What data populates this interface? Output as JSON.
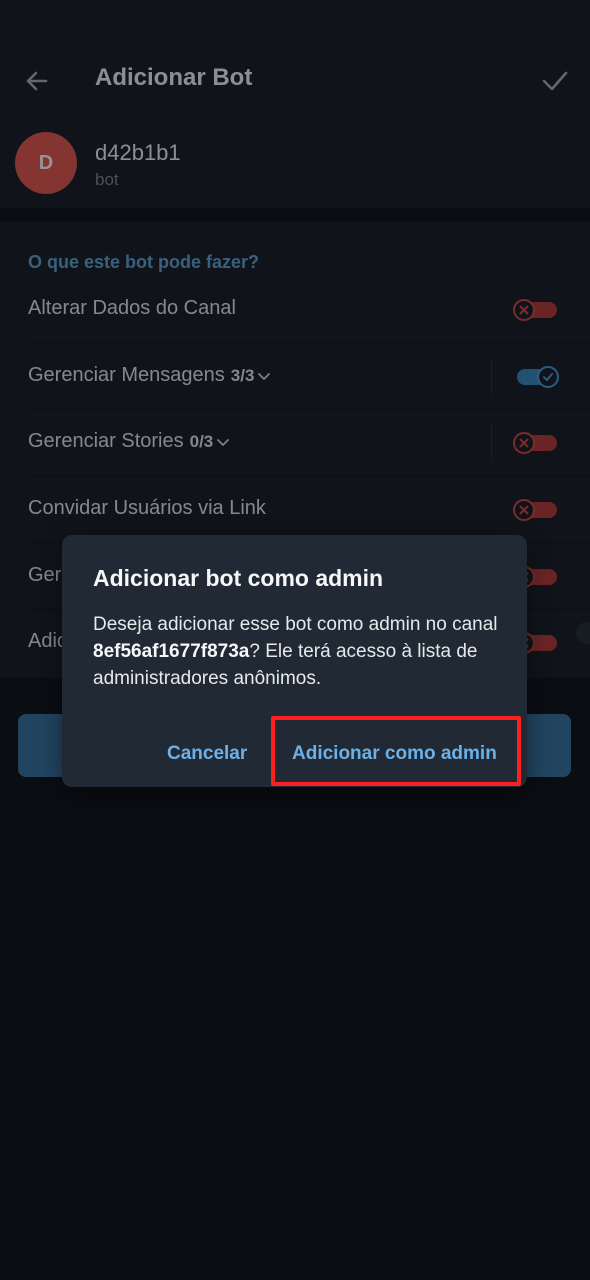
{
  "header": {
    "title": "Adicionar Bot",
    "back_icon": "arrow-left-icon",
    "confirm_icon": "check-icon"
  },
  "bot": {
    "avatar_letter": "D",
    "avatar_color": "#e35a55",
    "name": "d42b1b1",
    "subtitle": "bot"
  },
  "permissions": {
    "header": "O que este bot pode fazer?",
    "items": [
      {
        "label": "Alterar Dados do Canal",
        "count": "",
        "expandable": false,
        "enabled": false
      },
      {
        "label": "Gerenciar Mensagens",
        "count": "3/3",
        "expandable": true,
        "enabled": true
      },
      {
        "label": "Gerenciar Stories",
        "count": "0/3",
        "expandable": true,
        "enabled": false
      },
      {
        "label": "Convidar Usuários via Link",
        "count": "",
        "expandable": false,
        "enabled": false
      },
      {
        "label": "Gerenciar Transmissões",
        "count": "",
        "expandable": false,
        "enabled": false
      },
      {
        "label": "Adicionar Novos Admins",
        "count": "",
        "expandable": false,
        "enabled": false
      }
    ]
  },
  "dialog": {
    "title": "Adicionar bot como admin",
    "body_prefix": "Deseja adicionar esse bot como admin no canal ",
    "channel": "8ef56af1677f873a",
    "body_suffix": "? Ele terá acesso à lista de administradores anônimos.",
    "cancel_label": "Cancelar",
    "confirm_label": "Adicionar como admin"
  },
  "colors": {
    "background": "#121820",
    "surface": "#1c242e",
    "accent": "#62a7d8",
    "toggle_off": "#d64a4a",
    "toggle_on": "#4c9fe0",
    "highlight": "#ff1f1f"
  }
}
